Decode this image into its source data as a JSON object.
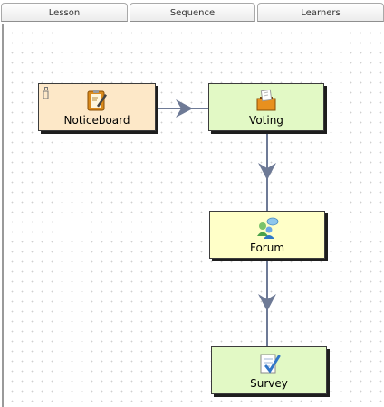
{
  "tabs": [
    {
      "label": "Lesson"
    },
    {
      "label": "Sequence"
    },
    {
      "label": "Learners"
    }
  ],
  "activities": [
    {
      "label": "Noticeboard",
      "icon": "noticeboard-icon",
      "color": "#fde8c8"
    },
    {
      "label": "Voting",
      "icon": "voting-icon",
      "color": "#e2f9c5"
    },
    {
      "label": "Forum",
      "icon": "forum-icon",
      "color": "#ffffc8"
    },
    {
      "label": "Survey",
      "icon": "survey-icon",
      "color": "#e2f9c5"
    }
  ],
  "colors": {
    "connector": "#6e7a96"
  }
}
